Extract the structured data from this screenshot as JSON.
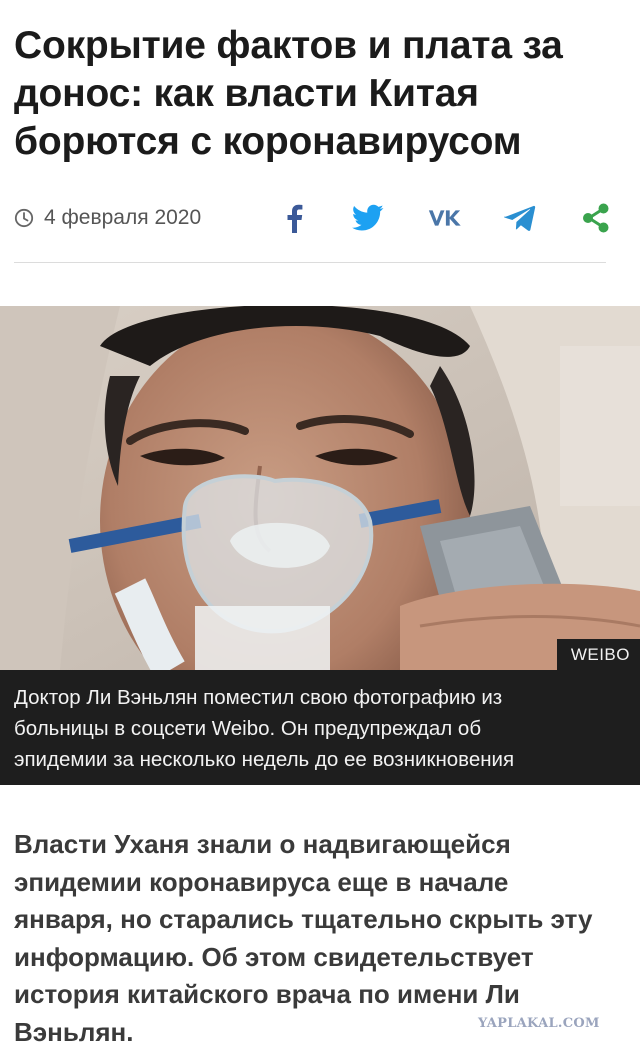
{
  "article": {
    "title_lines": [
      "Сокрытие фактов и плата за",
      "донос: как власти Китая",
      "борются с коронавирусом"
    ],
    "date": "4 февраля 2020",
    "photo_credit": "WEIBO",
    "caption_lines": [
      "Доктор Ли Вэньлян поместил свою фотографию из",
      "больницы в соцсети Weibo. Он предупреждал об",
      "эпидемии за несколько недель до ее возникновения"
    ],
    "lead_lines": [
      "Власти Уханя знали о надвигающейся",
      "эпидемии коронавируса еще в начале",
      "января, но старались тщательно скрыть эту",
      "информацию. Об этом свидетельствует",
      "история китайского врача по имени Ли",
      "Вэньлян."
    ]
  },
  "share": {
    "icons": [
      "facebook-icon",
      "twitter-icon",
      "vk-icon",
      "telegram-icon",
      "share-icon"
    ],
    "colors": {
      "facebook": "#3b5998",
      "twitter": "#1da1f2",
      "vk": "#4a76a8",
      "telegram": "#2a8fd1",
      "share": "#3aa34d"
    }
  },
  "watermark": "YAPLAKAL.COM"
}
